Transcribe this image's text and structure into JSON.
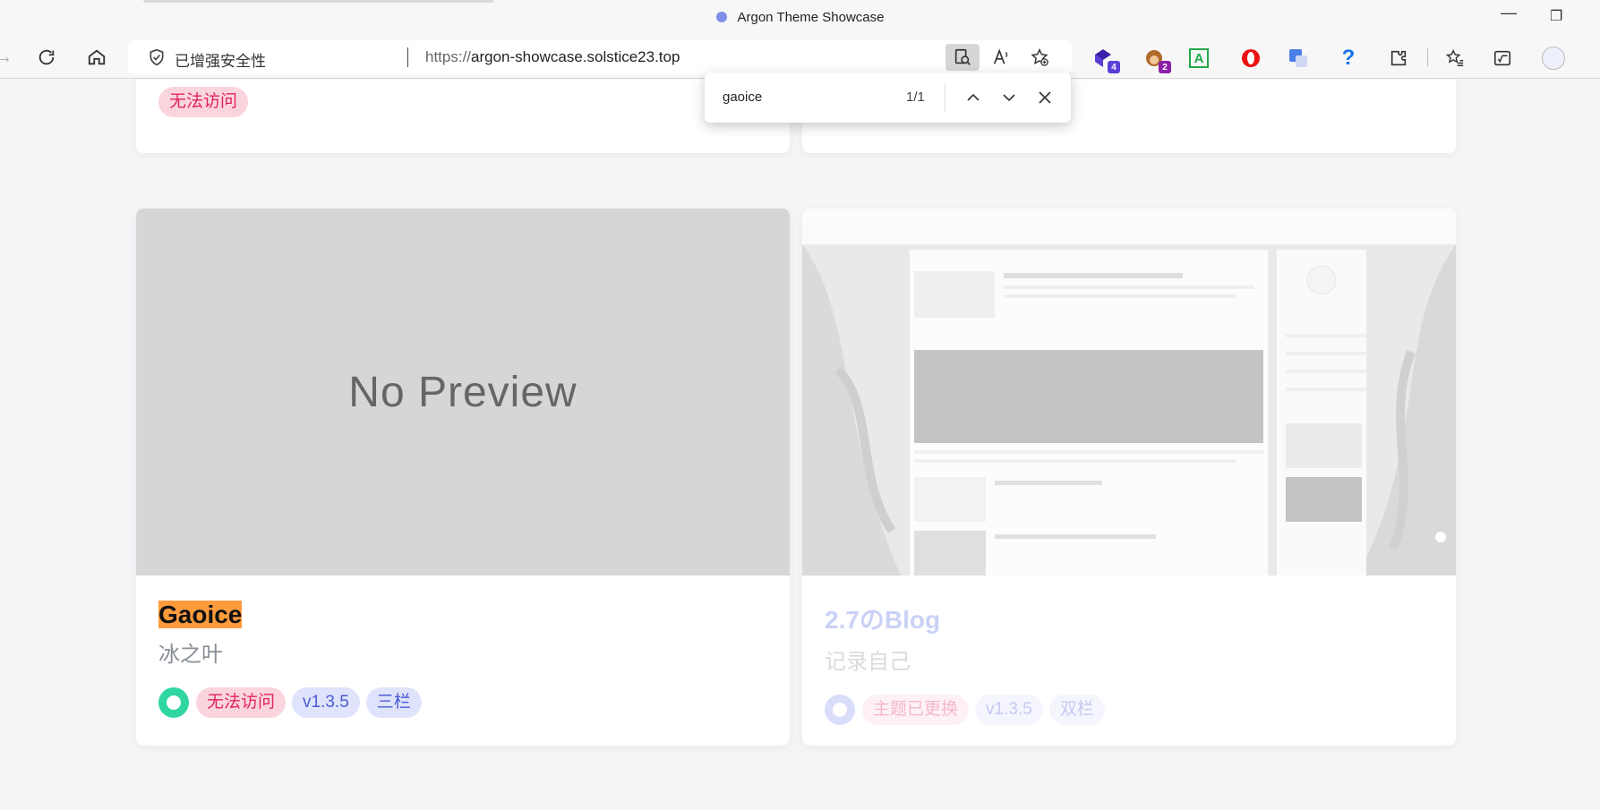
{
  "window": {
    "title": "Argon Theme Showcase"
  },
  "addressbar": {
    "security_label": "已增强安全性",
    "url_protocol": "https://",
    "url_host": "argon-showcase.solstice23.top"
  },
  "extensions": {
    "badge_1": "4",
    "badge_2": "2"
  },
  "findbar": {
    "query": "gaoice",
    "count": "1/1"
  },
  "cards_top": {
    "left_tag": "无法访问"
  },
  "cards": [
    {
      "preview_text": "No Preview",
      "title": "Gaoice",
      "subtitle": "冰之叶",
      "tags": [
        "无法访问",
        "v1.3.5",
        "三栏"
      ],
      "status_color": "#2fd6a2"
    },
    {
      "title": "2.7のBlog",
      "subtitle": "记录自己",
      "tags": [
        "主题已更换",
        "v1.3.5",
        "双栏"
      ],
      "status_color": "#8a99f0"
    }
  ],
  "colors": {
    "accent": "#5e72e4",
    "highlight": "#ff9b3d",
    "danger": "#e0245e"
  }
}
